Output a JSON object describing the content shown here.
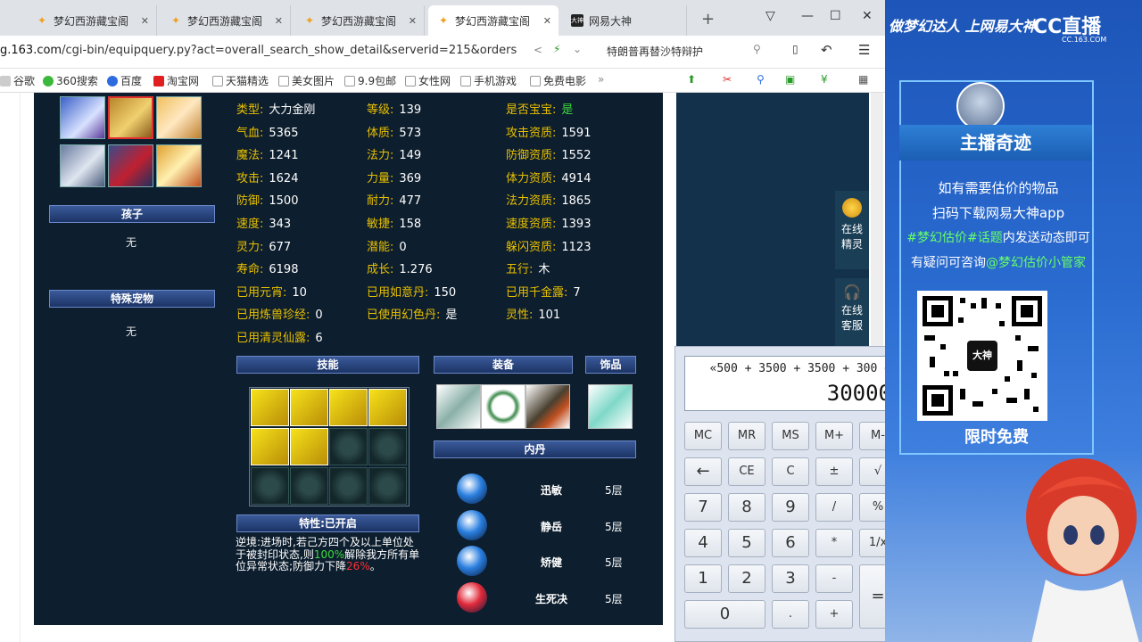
{
  "browser": {
    "tabs": [
      {
        "title": "梦幻西游藏宝阁"
      },
      {
        "title": "梦幻西游藏宝阁"
      },
      {
        "title": "梦幻西游藏宝阁"
      },
      {
        "title": "梦幻西游藏宝阁",
        "active": true
      },
      {
        "title": "网易大神"
      }
    ],
    "url_prefix": "g.163.com",
    "url_rest": "/cgi-bin/equipquery.py?act=overall_search_show_detail&serverid=215&orders",
    "search_text": "特朗普再替沙特辩护",
    "bookmarks": [
      "谷歌",
      "360搜索",
      "百度",
      "淘宝网",
      "天猫精选",
      "美女图片",
      "9.9包邮",
      "女性网",
      "手机游戏",
      "免费电影"
    ]
  },
  "pet": {
    "child_header": "孩子",
    "child_value": "无",
    "special_pet_header": "特殊宠物",
    "special_pet_value": "无",
    "stats": [
      {
        "label": "类型:",
        "value": "大力金刚"
      },
      {
        "label": "等级:",
        "value": "139"
      },
      {
        "label": "是否宝宝:",
        "value": "是",
        "green": true
      },
      {
        "label": "气血:",
        "value": "5365"
      },
      {
        "label": "体质:",
        "value": "573"
      },
      {
        "label": "攻击资质:",
        "value": "1591"
      },
      {
        "label": "魔法:",
        "value": "1241"
      },
      {
        "label": "法力:",
        "value": "149"
      },
      {
        "label": "防御资质:",
        "value": "1552"
      },
      {
        "label": "攻击:",
        "value": "1624"
      },
      {
        "label": "力量:",
        "value": "369"
      },
      {
        "label": "体力资质:",
        "value": "4914"
      },
      {
        "label": "防御:",
        "value": "1500"
      },
      {
        "label": "耐力:",
        "value": "477"
      },
      {
        "label": "法力资质:",
        "value": "1865"
      },
      {
        "label": "速度:",
        "value": "343"
      },
      {
        "label": "敏捷:",
        "value": "158"
      },
      {
        "label": "速度资质:",
        "value": "1393"
      },
      {
        "label": "灵力:",
        "value": "677"
      },
      {
        "label": "潜能:",
        "value": "0"
      },
      {
        "label": "躲闪资质:",
        "value": "1123"
      },
      {
        "label": "寿命:",
        "value": "6198"
      },
      {
        "label": "成长:",
        "value": "1.276"
      },
      {
        "label": "五行:",
        "value": "木"
      },
      {
        "label": "已用元宵:",
        "value": "10"
      },
      {
        "label": "已用如意丹:",
        "value": "150"
      },
      {
        "label": "已用千金露:",
        "value": "7"
      },
      {
        "label": "已用炼兽珍经:",
        "value": "0"
      },
      {
        "label": "已使用幻色丹:",
        "value": "是"
      },
      {
        "label": "灵性:",
        "value": "101"
      },
      {
        "label": "已用清灵仙露:",
        "value": "6"
      }
    ],
    "skills_header": "技能",
    "equip_header": "装备",
    "ornament_header": "饰品",
    "neidan_header": "内丹",
    "neidan": [
      {
        "name": "迅敏",
        "level": "5层",
        "color": "#2a7fe0"
      },
      {
        "name": "静岳",
        "level": "5层",
        "color": "#2a7fe0"
      },
      {
        "name": "矫健",
        "level": "5层",
        "color": "#2a7fe0"
      },
      {
        "name": "生死决",
        "level": "5层",
        "color": "#e02a3a"
      }
    ],
    "trait_header": "特性:已开启",
    "trait_text_1": "逆境:进场时,若己方四个及以上单位处于被封印状态,则",
    "trait_pct_1": "100%",
    "trait_text_2": "解除我方所有单位异常状态;防御力下降",
    "trait_pct_2": "26%",
    "trait_text_3": "。"
  },
  "side_buttons": [
    {
      "label_1": "在线",
      "label_2": "精灵"
    },
    {
      "label_1": "在线",
      "label_2": "客服"
    }
  ],
  "calculator": {
    "expression": "«500 + 3500 + 3500 + 300 +",
    "result": "30000",
    "keys": [
      "MC",
      "MR",
      "MS",
      "M+",
      "M-",
      "←",
      "CE",
      "C",
      "±",
      "√",
      "7",
      "8",
      "9",
      "/",
      "%",
      "4",
      "5",
      "6",
      "*",
      "1/x",
      "1",
      "2",
      "3",
      "-",
      "=",
      "0",
      ".",
      "+"
    ]
  },
  "stream": {
    "slogan": "做梦幻达人 上网易大神",
    "cc_brand": "CC直播",
    "cc_sub": "CC.163.COM",
    "anchor": "主播奇迹",
    "line1": "如有需要估价的物品",
    "line2": "扫码下载网易大神app",
    "line3_hl": "#梦幻估价#话题",
    "line3_rest": "内发送动态即可",
    "line4_pre": "有疑问可咨询",
    "line4_hl": "@梦幻估价小管家",
    "qr_center": "大神",
    "free": "限时免费"
  }
}
